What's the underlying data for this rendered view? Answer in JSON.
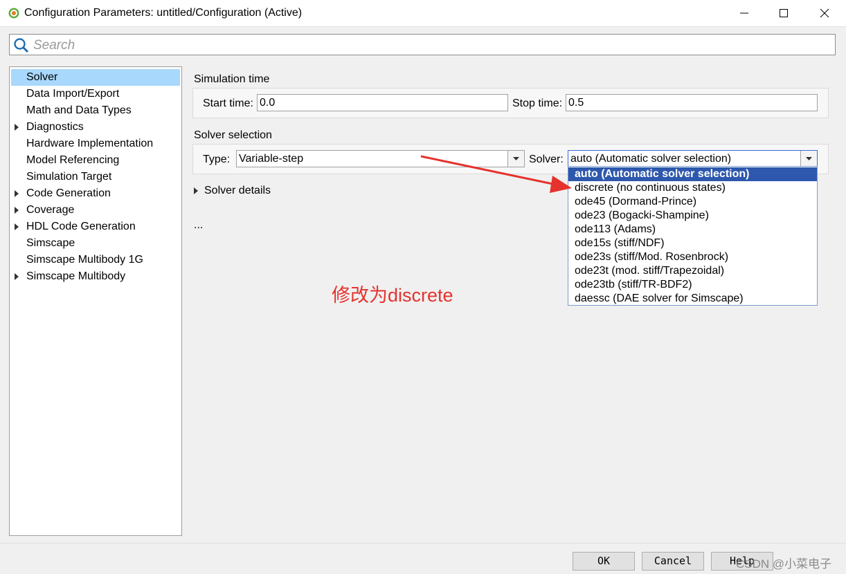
{
  "window": {
    "title": "Configuration Parameters: untitled/Configuration (Active)"
  },
  "search": {
    "placeholder": "Search"
  },
  "sidebar": {
    "items": [
      {
        "label": "Solver",
        "expandable": false,
        "selected": true
      },
      {
        "label": "Data Import/Export",
        "expandable": false
      },
      {
        "label": "Math and Data Types",
        "expandable": false
      },
      {
        "label": "Diagnostics",
        "expandable": true
      },
      {
        "label": "Hardware Implementation",
        "expandable": false
      },
      {
        "label": "Model Referencing",
        "expandable": false
      },
      {
        "label": "Simulation Target",
        "expandable": false
      },
      {
        "label": "Code Generation",
        "expandable": true
      },
      {
        "label": "Coverage",
        "expandable": true
      },
      {
        "label": "HDL Code Generation",
        "expandable": true
      },
      {
        "label": "Simscape",
        "expandable": false
      },
      {
        "label": "Simscape Multibody 1G",
        "expandable": false
      },
      {
        "label": "Simscape Multibody",
        "expandable": true
      }
    ]
  },
  "main": {
    "simulation_time": {
      "heading": "Simulation time",
      "start_label": "Start time:",
      "start_value": "0.0",
      "stop_label": "Stop time:",
      "stop_value": "0.5"
    },
    "solver_selection": {
      "heading": "Solver selection",
      "type_label": "Type:",
      "type_value": "Variable-step",
      "solver_label": "Solver:",
      "solver_value": "auto (Automatic solver selection)",
      "options": [
        "auto (Automatic solver selection)",
        "discrete (no continuous states)",
        "ode45 (Dormand-Prince)",
        "ode23 (Bogacki-Shampine)",
        "ode113 (Adams)",
        "ode15s (stiff/NDF)",
        "ode23s (stiff/Mod. Rosenbrock)",
        "ode23t (mod. stiff/Trapezoidal)",
        "ode23tb (stiff/TR-BDF2)",
        "daessc (DAE solver for Simscape)"
      ]
    },
    "solver_details_label": "Solver details",
    "ellipsis": "..."
  },
  "annotation": {
    "text": "修改为discrete",
    "color": "#e5322d"
  },
  "footer": {
    "ok_label": "OK",
    "cancel_label": "Cancel",
    "help_label": "Help"
  },
  "watermark": "CSDN @小菜电子",
  "colors": {
    "selection_blue": "#2e58ad",
    "nav_selected": "#a8d8fb",
    "arrow_red": "#e5322d"
  }
}
